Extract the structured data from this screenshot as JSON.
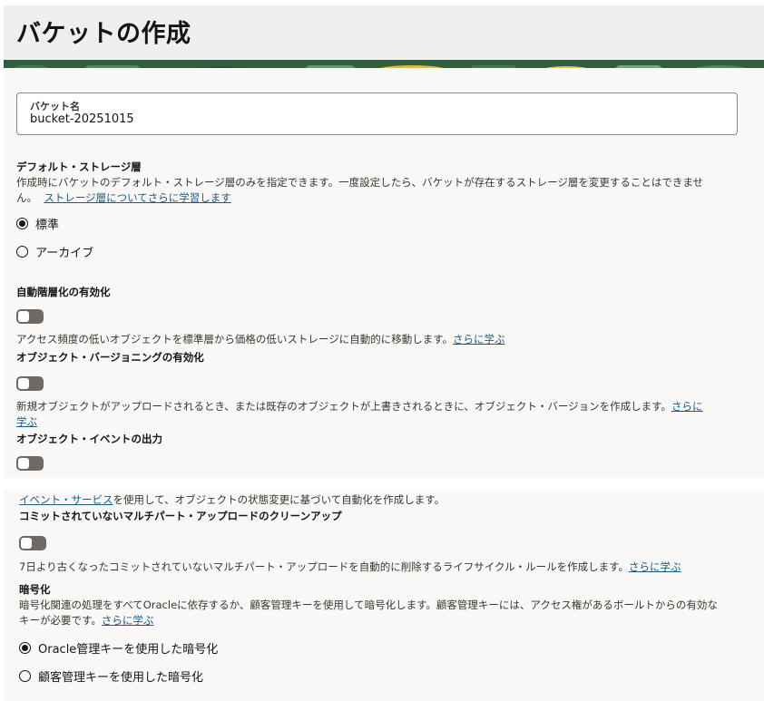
{
  "header": {
    "title": "バケットの作成"
  },
  "bucket_name": {
    "label": "バケット名",
    "value": "bucket-20251015"
  },
  "storage_tier": {
    "heading": "デフォルト・ストレージ層",
    "description_line1": "作成時にバケットのデフォルト・ストレージ層のみを指定できます。一度設定したら、バケットが存在するストレージ層を変更することはできませ",
    "description_line2": "ん。",
    "link": "ストレージ層についてさらに学習します",
    "options": [
      {
        "label": "標準",
        "selected": true
      },
      {
        "label": "アーカイブ",
        "selected": false
      }
    ]
  },
  "auto_tiering": {
    "heading": "自動階層化の有効化",
    "enabled": false,
    "description": "アクセス頻度の低いオブジェクトを標準層から価格の低いストレージに自動的に移動します。",
    "link": "さらに学ぶ"
  },
  "versioning": {
    "heading": "オブジェクト・バージョニングの有効化",
    "enabled": false,
    "description": "新規オブジェクトがアップロードされるとき、または既存のオブジェクトが上書きされるときに、オブジェクト・バージョンを作成します。",
    "link_part1": "さらに",
    "link_part2": "学ぶ"
  },
  "events": {
    "heading": "オブジェクト・イベントの出力",
    "enabled": false,
    "link": "イベント・サービス",
    "description": "を使用して、オブジェクトの状態変更に基づいて自動化を作成します。"
  },
  "multipart_cleanup": {
    "heading": "コミットされていないマルチパート・アップロードのクリーンアップ",
    "enabled": false,
    "description": "7日より古くなったコミットされていないマルチパート・アップロードを自動的に削除するライフサイクル・ルールを作成します。",
    "link": "さらに学ぶ"
  },
  "encryption": {
    "heading": "暗号化",
    "description_line1": "暗号化関連の処理をすべてOracleに依存するか、顧客管理キーを使用して暗号化します。顧客管理キーには、アクセス権があるボールトからの有効な",
    "description_line2": "キーが必要です。",
    "link": "さらに学ぶ",
    "options": [
      {
        "label": "Oracle管理キーを使用した暗号化",
        "selected": true
      },
      {
        "label": "顧客管理キーを使用した暗号化",
        "selected": false
      }
    ]
  },
  "colors": {
    "link": "#1b5c85",
    "toggle_off": "#6f6964",
    "panel_bg": "#f9f8f6",
    "header_bg": "#f0efed"
  }
}
